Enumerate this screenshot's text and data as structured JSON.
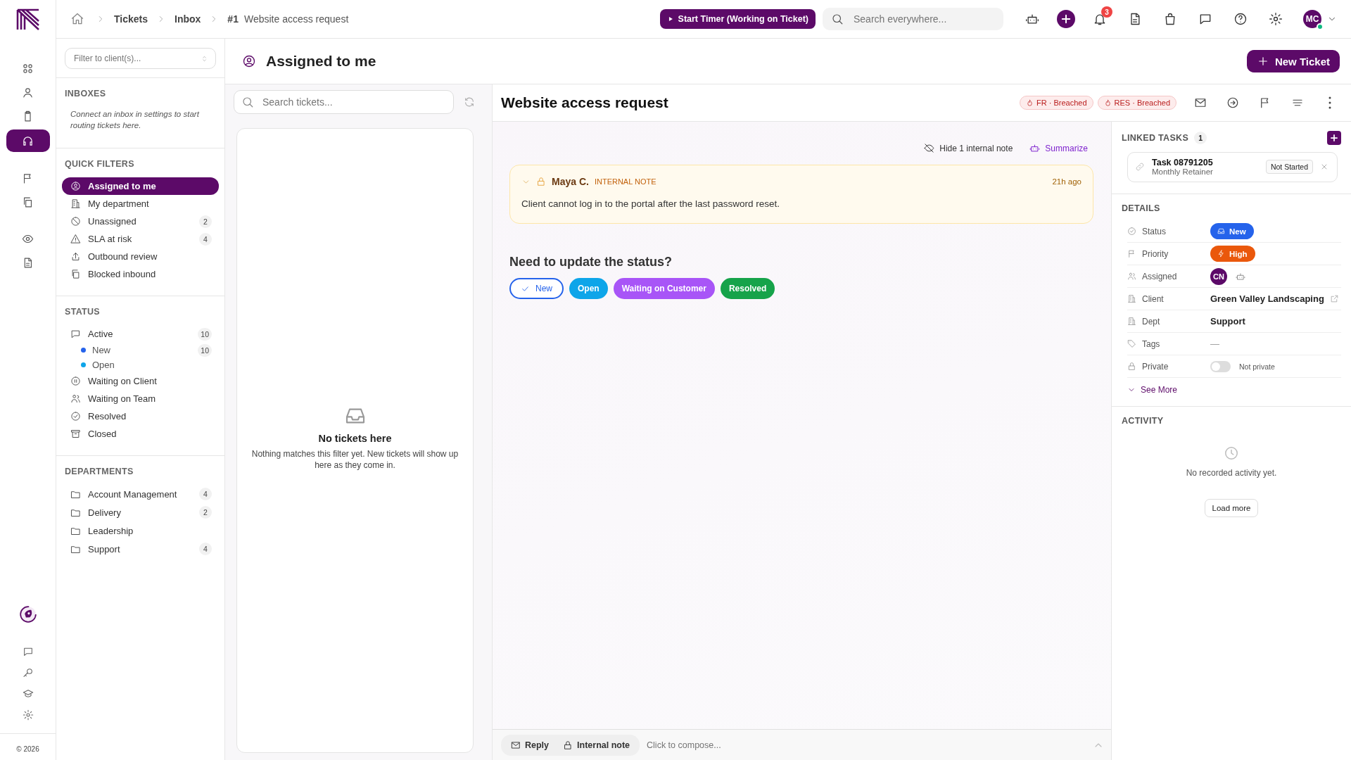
{
  "top_bar": {
    "breadcrumbs": [
      {
        "label": "Tickets"
      },
      {
        "label": "Inbox"
      }
    ],
    "ticket_number": "#1",
    "ticket_title": "Website access request",
    "timer_button": "Start Timer (Working on Ticket)",
    "search": {
      "placeholder": "Search everywhere..."
    },
    "notification_count": "3",
    "user_initials": "MC"
  },
  "rail": {
    "items": [
      {
        "selected": false
      },
      {
        "selected": false
      },
      {
        "selected": false
      },
      {
        "selected": true
      },
      {
        "selected": false
      },
      {
        "selected": false
      },
      {
        "selected": false
      },
      {
        "selected": false
      }
    ],
    "footer": "© 2026"
  },
  "sidebar": {
    "client_filter": {
      "placeholder": "Filter to client(s)..."
    },
    "inboxes": {
      "title": "INBOXES",
      "hint": "Connect an inbox in settings to start routing tickets here."
    },
    "quick_filters": {
      "title": "QUICK FILTERS",
      "items": [
        {
          "label": "Assigned to me",
          "selected": true
        },
        {
          "label": "My department",
          "selected": false
        },
        {
          "label": "Unassigned",
          "count": "2",
          "selected": false
        },
        {
          "label": "SLA at risk",
          "count": "4",
          "selected": false
        },
        {
          "label": "Outbound review",
          "selected": false
        },
        {
          "label": "Blocked inbound",
          "selected": false
        }
      ]
    },
    "status": {
      "title": "STATUS",
      "items": [
        {
          "label": "Active",
          "count": "10",
          "selected": false,
          "children": [
            {
              "label": "New",
              "count": "10",
              "color": "#2563eb",
              "selected": false
            },
            {
              "label": "Open",
              "color": "#0ea5e9",
              "selected": false
            }
          ]
        },
        {
          "label": "Waiting on Client",
          "selected": false
        },
        {
          "label": "Waiting on Team",
          "selected": false
        },
        {
          "label": "Resolved",
          "selected": false
        },
        {
          "label": "Closed",
          "selected": false
        }
      ]
    },
    "departments": {
      "title": "DEPARTMENTS",
      "items": [
        {
          "label": "Account Management",
          "count": "4",
          "selected": false
        },
        {
          "label": "Delivery",
          "count": "2",
          "selected": false
        },
        {
          "label": "Leadership",
          "selected": false
        },
        {
          "label": "Support",
          "count": "4",
          "selected": false
        }
      ]
    }
  },
  "page_header": {
    "title": "Assigned to me",
    "new_ticket_button": "New Ticket"
  },
  "ticket_list": {
    "search": {
      "placeholder": "Search tickets..."
    },
    "empty_title": "No tickets here",
    "empty_text": "Nothing matches this filter yet. New tickets will show up here as they come in."
  },
  "ticket": {
    "title": "Website access request",
    "sla_badges": [
      {
        "label": "FR · Breached"
      },
      {
        "label": "RES · Breached"
      }
    ],
    "hide_notes": "Hide 1 internal note",
    "summarize": "Summarize",
    "note": {
      "author": "Maya C.",
      "label": "INTERNAL NOTE",
      "time": "21h ago",
      "text": "Client cannot log in to the portal after the last password reset."
    },
    "status_prompt": "Need to update the status?",
    "status_options": [
      {
        "label": "New",
        "selected": true,
        "color": "#2563eb"
      },
      {
        "label": "Open",
        "selected": false,
        "color": "#0ea5e9"
      },
      {
        "label": "Waiting on Customer",
        "selected": false,
        "color": "#a855f7"
      },
      {
        "label": "Resolved",
        "selected": false,
        "color": "#16a34a"
      }
    ],
    "composer": {
      "modes": [
        {
          "label": "Reply"
        },
        {
          "label": "Internal note"
        }
      ],
      "placeholder": "Click to compose..."
    }
  },
  "right_panel": {
    "linked_tasks": {
      "title": "LINKED TASKS",
      "count": "1",
      "tasks": [
        {
          "name": "Task 08791205",
          "subtitle": "Monthly Retainer",
          "status": "Not Started"
        }
      ]
    },
    "details": {
      "title": "DETAILS",
      "rows": [
        {
          "label": "Status",
          "kind": "badge",
          "value": "New",
          "color": "#2563eb"
        },
        {
          "label": "Priority",
          "kind": "badge",
          "value": "High",
          "color": "#ea580c"
        },
        {
          "label": "Assigned",
          "kind": "avatar",
          "value": "CN"
        },
        {
          "label": "Client",
          "kind": "link",
          "value": "Green Valley Landscaping"
        },
        {
          "label": "Dept",
          "kind": "text",
          "value": "Support"
        },
        {
          "label": "Tags",
          "kind": "empty",
          "value": "—"
        },
        {
          "label": "Private",
          "kind": "toggle",
          "on": false,
          "value": "Not private"
        }
      ],
      "see_more": "See More"
    },
    "activity": {
      "title": "ACTIVITY",
      "empty_text": "No recorded activity yet.",
      "load_more": "Load more"
    }
  }
}
